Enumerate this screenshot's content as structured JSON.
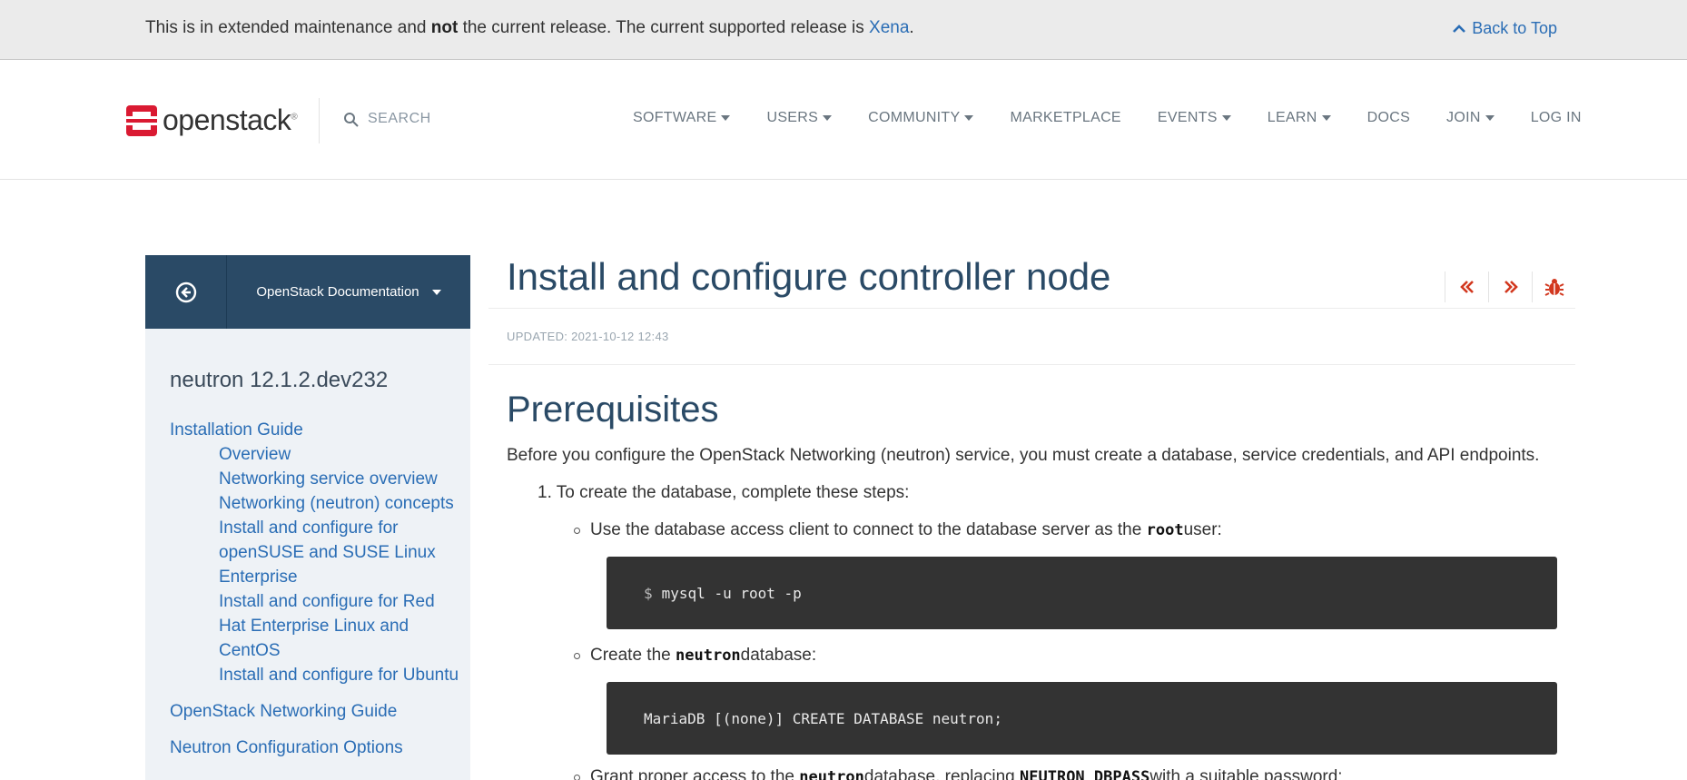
{
  "notice": {
    "text_before": "This is in extended maintenance and ",
    "text_bold": "not",
    "text_after": " the current release. The current supported release is ",
    "release_link": "Xena",
    "text_end": ".",
    "back_to_top": "Back to Top"
  },
  "header": {
    "logo_text": "openstack",
    "logo_mark": "®",
    "search_placeholder": "SEARCH",
    "nav": [
      {
        "label": "SOFTWARE",
        "dropdown": true
      },
      {
        "label": "USERS",
        "dropdown": true
      },
      {
        "label": "COMMUNITY",
        "dropdown": true
      },
      {
        "label": "MARKETPLACE",
        "dropdown": false
      },
      {
        "label": "EVENTS",
        "dropdown": true
      },
      {
        "label": "LEARN",
        "dropdown": true
      },
      {
        "label": "DOCS",
        "dropdown": false
      },
      {
        "label": "JOIN",
        "dropdown": true
      },
      {
        "label": "LOG IN",
        "dropdown": false
      }
    ]
  },
  "sidebar": {
    "docs_dropdown": "OpenStack Documentation",
    "version": "neutron 12.1.2.dev232",
    "items": [
      {
        "label": "Installation Guide",
        "sub": false
      },
      {
        "label": "Overview",
        "sub": true
      },
      {
        "label": "Networking service overview",
        "sub": true
      },
      {
        "label": "Networking (neutron) concepts",
        "sub": true
      },
      {
        "label": "Install and configure for openSUSE and SUSE Linux Enterprise",
        "sub": true
      },
      {
        "label": "Install and configure for Red Hat Enterprise Linux and CentOS",
        "sub": true
      },
      {
        "label": "Install and configure for Ubuntu",
        "sub": true
      },
      {
        "label": "OpenStack Networking Guide",
        "sub": false
      },
      {
        "label": "Neutron Configuration Options",
        "sub": false
      }
    ]
  },
  "main": {
    "title": "Install and configure controller node",
    "updated": "UPDATED: 2021-10-12 12:43",
    "section_title": "Prerequisites",
    "intro": "Before you configure the OpenStack Networking (neutron) service, you must create a database, service credentials, and API endpoints.",
    "step1": "1. To create the database, complete these steps:",
    "bullet1": {
      "before": "Use the database access client to connect to the database server as the ",
      "code": "root",
      "after": " user:"
    },
    "code1": {
      "prompt": "$",
      "command": "mysql -u root -p"
    },
    "bullet2": {
      "before": "Create the ",
      "code": "neutron",
      "after": " database:"
    },
    "code2": {
      "command": "MariaDB [(none)] CREATE DATABASE neutron;"
    },
    "bullet3": {
      "before": "Grant proper access to the ",
      "code": "neutron",
      "middle": " database, replacing ",
      "code2": "NEUTRON_DBPASS",
      "after": " with a suitable password:"
    }
  },
  "colors": {
    "brand_red": "#da1a32",
    "link": "#2a6db5",
    "sidebar_head": "#2a4a66",
    "action_red": "#d2381f",
    "code_bg": "#333333"
  }
}
